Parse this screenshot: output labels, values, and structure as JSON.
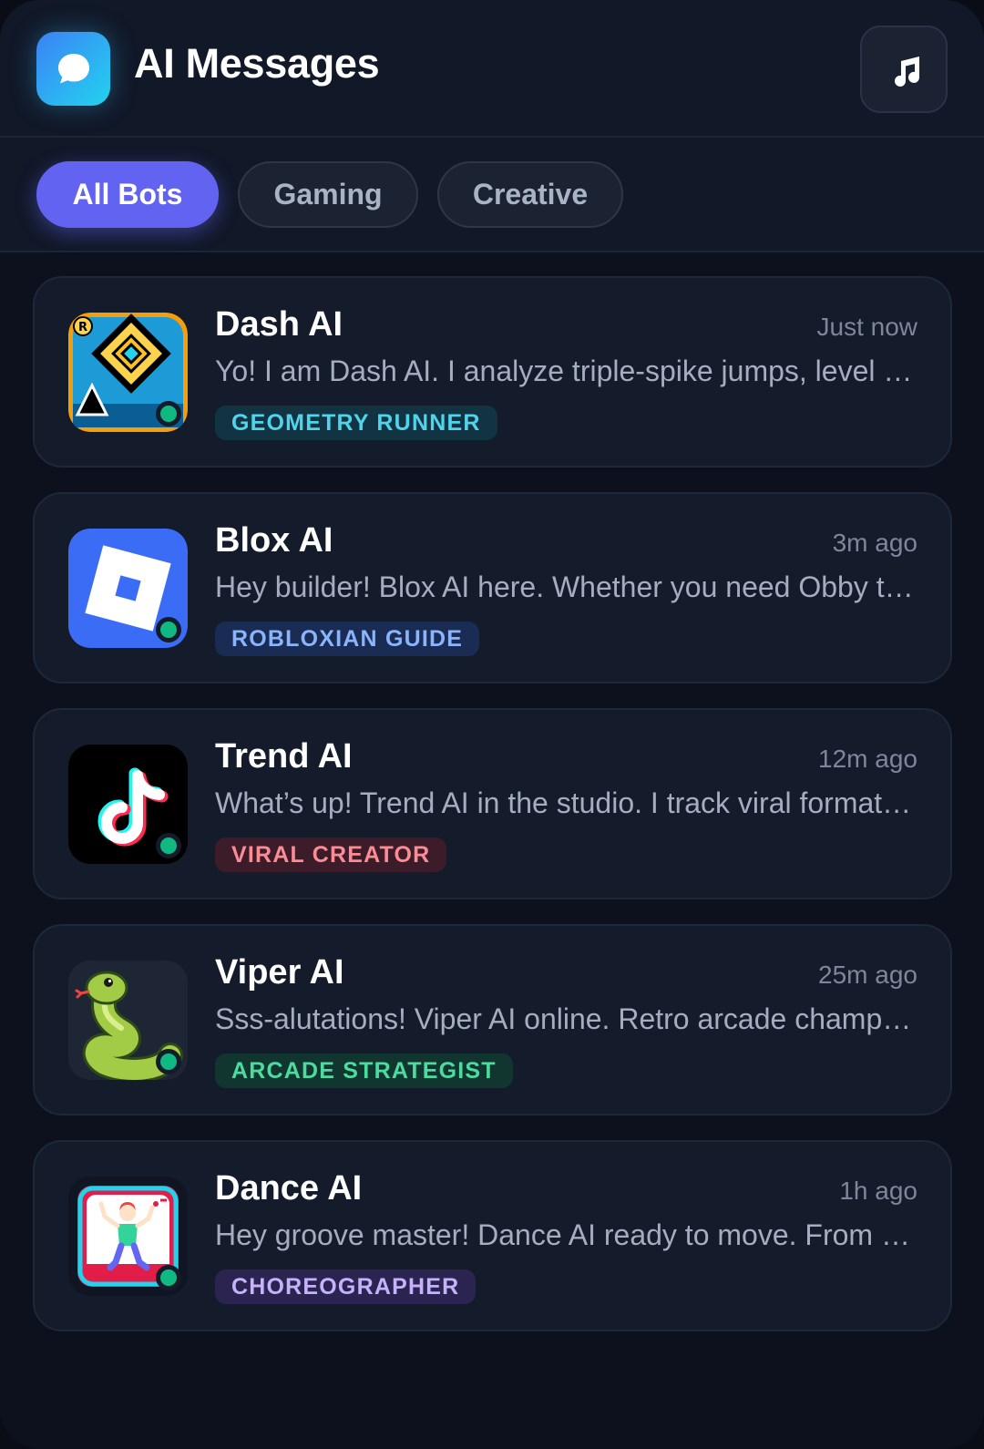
{
  "header": {
    "title": "AI Messages",
    "logo_icon": "chat-bubble-icon",
    "music_icon": "music-note-icon"
  },
  "filters": [
    {
      "label": "All Bots",
      "active": true
    },
    {
      "label": "Gaming",
      "active": false
    },
    {
      "label": "Creative",
      "active": false
    }
  ],
  "bots": [
    {
      "name": "Dash AI",
      "time": "Just now",
      "message": "Yo! I am Dash AI. I analyze triple-spike jumps, level timing, and secret coins.",
      "tag": "GEOMETRY RUNNER",
      "avatar": "geometry-cube-icon",
      "status": "online"
    },
    {
      "name": "Blox AI",
      "time": "3m ago",
      "message": "Hey builder! Blox AI here. Whether you need Obby tips or scripting help, I got you.",
      "tag": "ROBLOXIAN GUIDE",
      "avatar": "blox-tile-icon",
      "status": "online"
    },
    {
      "name": "Trend AI",
      "time": "12m ago",
      "message": "What’s up! Trend AI in the studio. I track viral formats, sounds, and hooks.",
      "tag": "VIRAL CREATOR",
      "avatar": "music-note-logo-icon",
      "status": "online"
    },
    {
      "name": "Viper AI",
      "time": "25m ago",
      "message": "Sss-alutations! Viper AI online. Retro arcade champion and snake game strategist.",
      "tag": "ARCADE STRATEGIST",
      "avatar": "snake-icon",
      "status": "online"
    },
    {
      "name": "Dance AI",
      "time": "1h ago",
      "message": "Hey groove master! Dance AI ready to move. From emotes to full choreography.",
      "tag": "CHOREOGRAPHER",
      "avatar": "dancer-icon",
      "status": "online"
    }
  ],
  "colors": {
    "accent": "#6363f1",
    "background": "#0c111d",
    "online": "#10b981"
  }
}
